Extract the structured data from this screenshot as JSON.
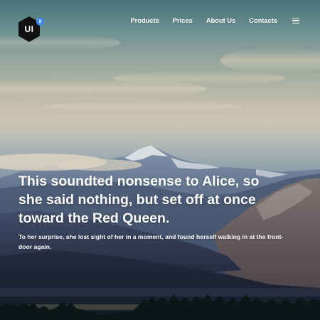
{
  "logo": {
    "text": "UI",
    "badge": "8",
    "color": "#111111",
    "badge_color": "#3d8bff"
  },
  "nav": {
    "items": [
      {
        "label": "Products"
      },
      {
        "label": "Prices"
      },
      {
        "label": "About Us"
      },
      {
        "label": "Contacts"
      }
    ],
    "menu_icon": "hamburger-icon"
  },
  "hero": {
    "headline": "This soundted nonsense to Alice, so she said nothing, but set off at once toward the Red Queen.",
    "subtext": "To her surprise, she lost sight of her in a moment, and found herself walking in at the front-door again.",
    "background": "mountain-landscape-image"
  }
}
